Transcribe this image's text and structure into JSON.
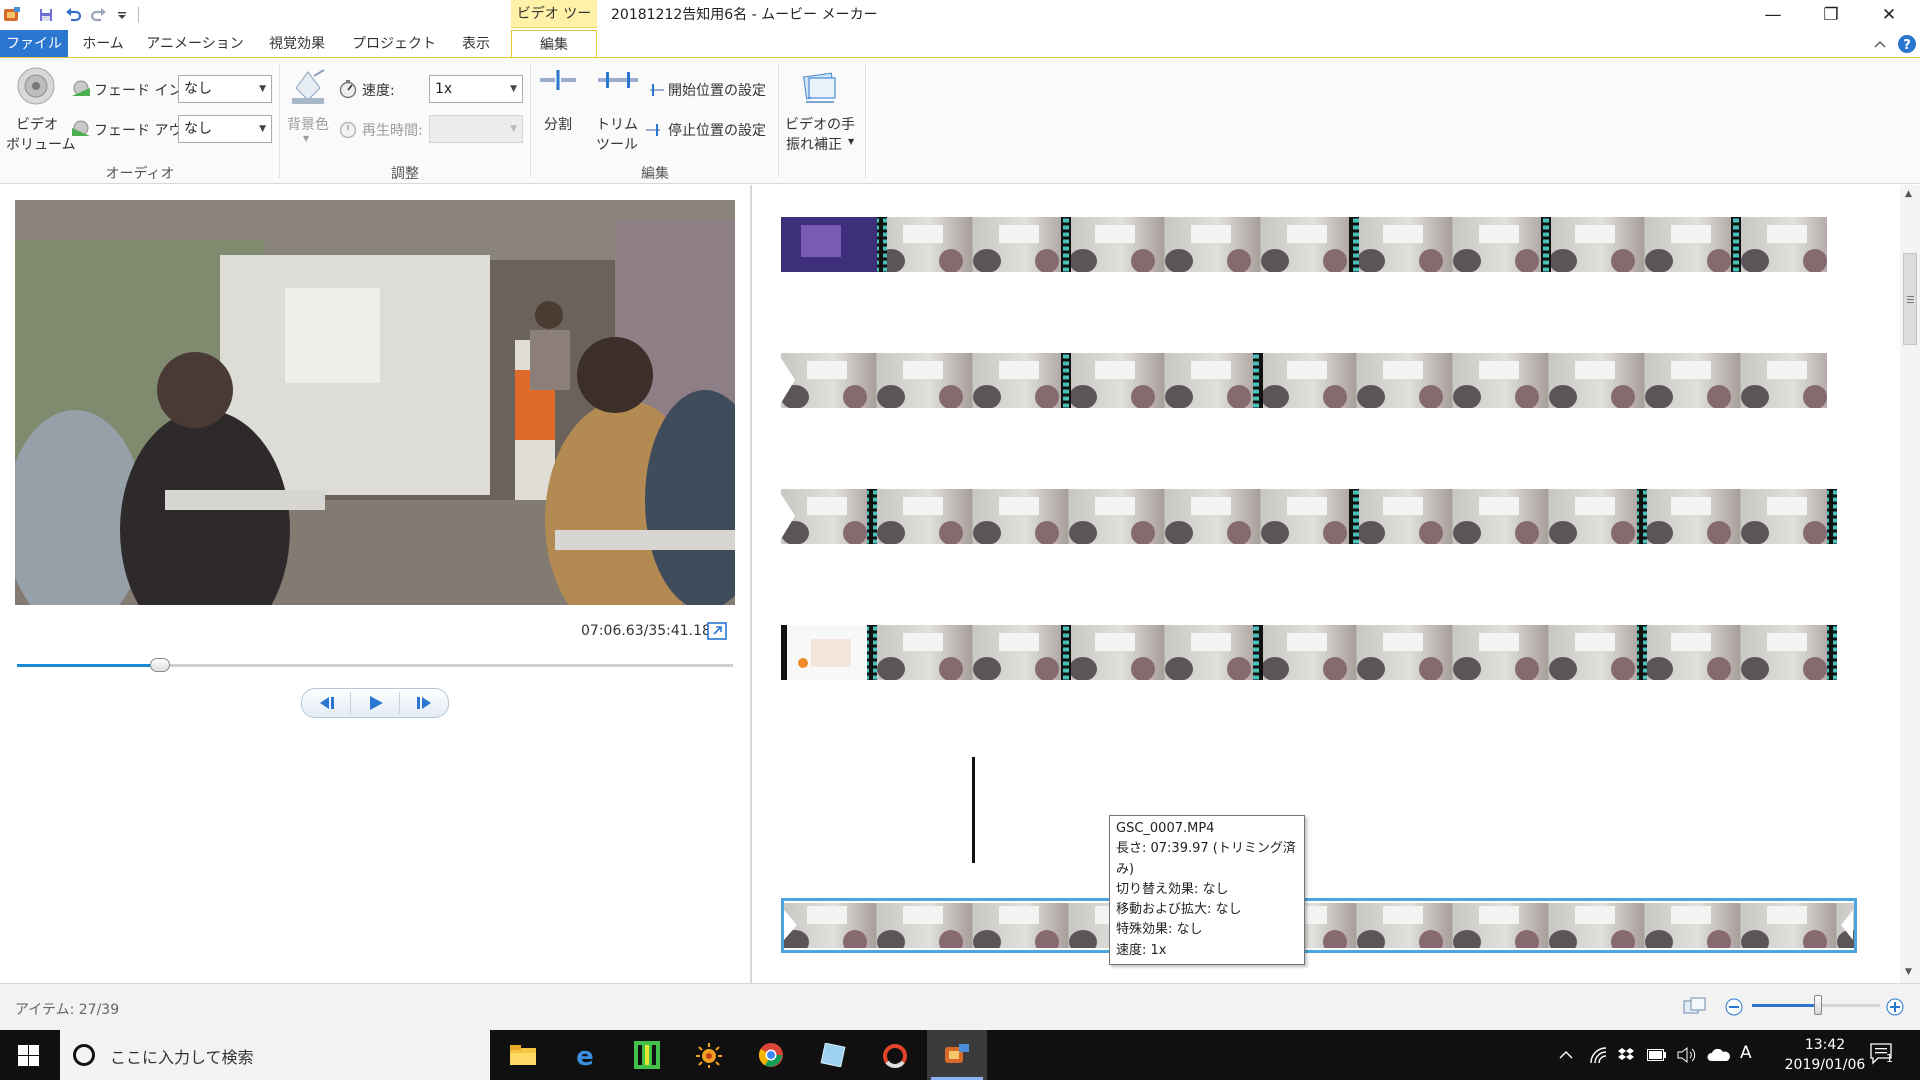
{
  "window": {
    "context_tab": "ビデオ ツール",
    "title": "20181212告知用6名 - ムービー メーカー",
    "minimize_glyph": "—",
    "maximize_glyph": "❐",
    "close_glyph": "✕"
  },
  "tabs": [
    {
      "label": "ファイル",
      "active": false
    },
    {
      "label": "ホーム",
      "active": false
    },
    {
      "label": "アニメーション",
      "active": false
    },
    {
      "label": "視覚効果",
      "active": false
    },
    {
      "label": "プロジェクト",
      "active": false
    },
    {
      "label": "表示",
      "active": false
    },
    {
      "label": "編集",
      "active": true
    }
  ],
  "ribbon": {
    "audio": {
      "video_volume_l1": "ビデオ",
      "video_volume_l2": "ボリューム",
      "fade_in_label": "フェード イン:",
      "fade_in_value": "なし",
      "fade_out_label": "フェード アウト:",
      "fade_out_value": "なし",
      "group": "オーディオ"
    },
    "adjust": {
      "bg_color": "背景色",
      "speed_label": "速度:",
      "speed_value": "1x",
      "duration_label": "再生時間:",
      "duration_value": "",
      "group": "調整"
    },
    "edit": {
      "split": "分割",
      "trim_l1": "トリム",
      "trim_l2": "ツール",
      "set_start": "開始位置の設定",
      "set_end": "停止位置の設定",
      "group": "編集"
    },
    "stabilize": {
      "l1": "ビデオの手",
      "l2": "振れ補正"
    }
  },
  "player": {
    "timecode": "07:06.63/35:41.18",
    "progress": 0.2
  },
  "tooltip": {
    "filename": "GSC_0007.MP4",
    "length": "長さ: 07:39.97 (トリミング済み)",
    "transition": "切り替え効果: なし",
    "pan_zoom": "移動および拡大: なし",
    "effect": "特殊効果: なし",
    "speed": "速度: 1x"
  },
  "status": {
    "items": "アイテム: 27/39"
  },
  "taskbar": {
    "search_placeholder": "ここに入力して検索",
    "time": "13:42",
    "date": "2019/01/06",
    "ime": "A",
    "notification_count": "1"
  },
  "colors": {
    "accent": "#2b76d0",
    "context_tab": "#fff2a8",
    "selection": "#4aa6dc",
    "seek": "#1e88d8"
  }
}
